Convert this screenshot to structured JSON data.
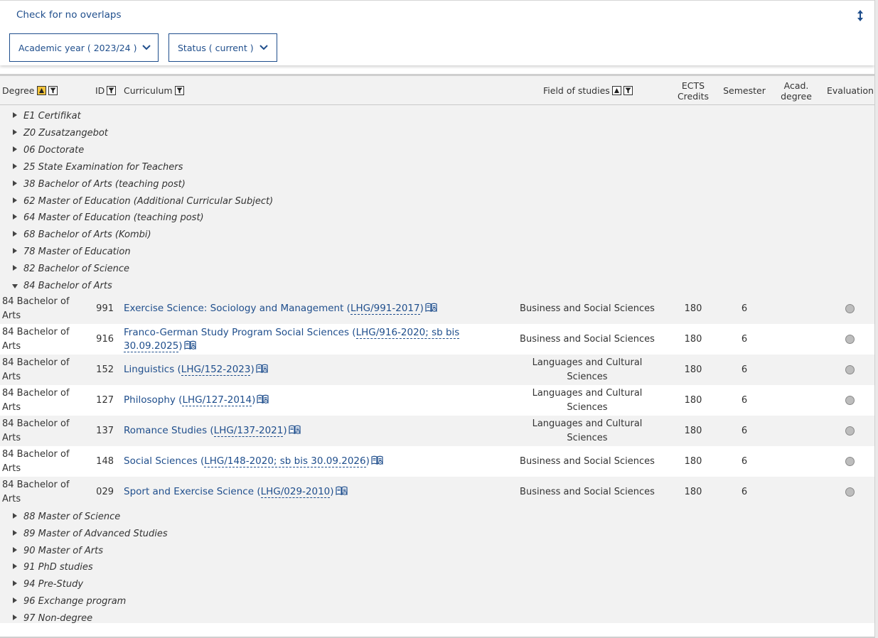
{
  "top": {
    "check_link": "Check for no overlaps",
    "year_filter": "Academic year ( 2023/24 )",
    "status_filter": "Status ( current )"
  },
  "columns": {
    "degree": "Degree",
    "id": "ID",
    "curriculum": "Curriculum",
    "field": "Field of studies",
    "ects_line1": "ECTS",
    "ects_line2": "Credits",
    "semester": "Semester",
    "acad_line1": "Acad.",
    "acad_line2": "degree",
    "evaluation": "Evaluation"
  },
  "groups_before": [
    "E1 Certifikat",
    "Z0 Zusatzangebot",
    "06 Doctorate",
    "25 State Examination for Teachers",
    "38 Bachelor of Arts (teaching post)",
    "62 Master of Education (Additional Curricular Subject)",
    "64 Master of Education (teaching post)",
    "68 Bachelor of Arts (Kombi)",
    "78 Master of Education",
    "82 Bachelor of Science"
  ],
  "expanded_group": "84 Bachelor of Arts",
  "rows": [
    {
      "deg1": "84 Bachelor of",
      "deg2": "Arts",
      "id": "991",
      "title": "Exercise Science: Sociology and Management (",
      "code": "LHG/991-2017",
      "close": ")",
      "field1": "Business and Social Sciences",
      "field2": "",
      "ects": "180",
      "sem": "6"
    },
    {
      "deg1": "84 Bachelor of",
      "deg2": "Arts",
      "id": "916",
      "title": "Franco-German Study Program Social Sciences (",
      "code": "LHG/916-2020; sb bis 30.09.2025",
      "close": ")",
      "field1": "Business and Social Sciences",
      "field2": "",
      "ects": "180",
      "sem": "6"
    },
    {
      "deg1": "84 Bachelor of",
      "deg2": "Arts",
      "id": "152",
      "title": "Linguistics (",
      "code": "LHG/152-2023",
      "close": ")",
      "field1": "Languages and Cultural",
      "field2": "Sciences",
      "ects": "180",
      "sem": "6"
    },
    {
      "deg1": "84 Bachelor of",
      "deg2": "Arts",
      "id": "127",
      "title": "Philosophy (",
      "code": "LHG/127-2014",
      "close": ")",
      "field1": "Languages and Cultural",
      "field2": "Sciences",
      "ects": "180",
      "sem": "6"
    },
    {
      "deg1": "84 Bachelor of",
      "deg2": "Arts",
      "id": "137",
      "title": "Romance Studies (",
      "code": "LHG/137-2021",
      "close": ")",
      "field1": "Languages and Cultural",
      "field2": "Sciences",
      "ects": "180",
      "sem": "6"
    },
    {
      "deg1": "84 Bachelor of",
      "deg2": "Arts",
      "id": "148",
      "title": "Social Sciences (",
      "code": "LHG/148-2020; sb bis 30.09.2026",
      "close": ")",
      "field1": "Business and Social Sciences",
      "field2": "",
      "ects": "180",
      "sem": "6"
    },
    {
      "deg1": "84 Bachelor of",
      "deg2": "Arts",
      "id": "029",
      "title": "Sport and Exercise Science (",
      "code": "LHG/029-2010",
      "close": ")",
      "field1": "Business and Social Sciences",
      "field2": "",
      "ects": "180",
      "sem": "6"
    }
  ],
  "groups_after": [
    "88 Master of Science",
    "89 Master of Advanced Studies",
    "90 Master of Arts",
    "91 PhD studies",
    "94 Pre-Study",
    "96 Exchange program",
    "97 Non-degree"
  ],
  "colors": {
    "link": "#1f4e8c",
    "sort_active": "#f3c43b",
    "row_alt": "#ffffff",
    "row_base": "#f2f2f2"
  }
}
